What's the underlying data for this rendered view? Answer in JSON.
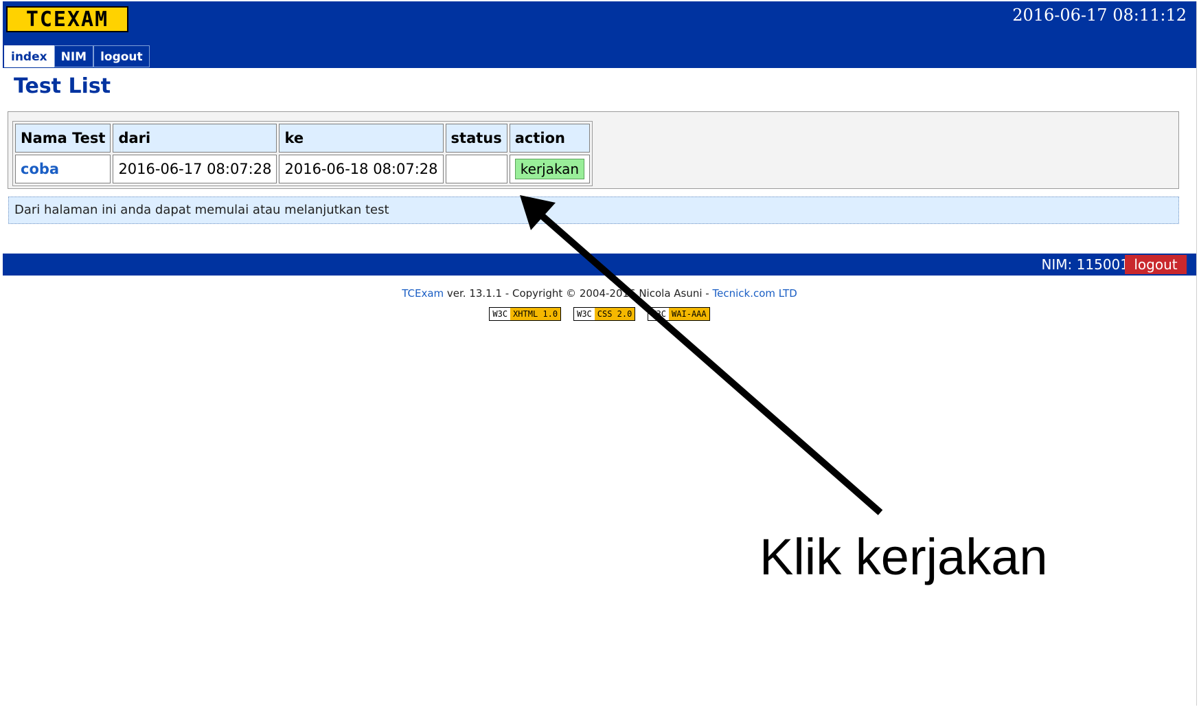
{
  "header": {
    "logo_text": "TCEXAM",
    "datetime": "2016-06-17 08:11:12"
  },
  "tabs": [
    {
      "label": "index",
      "active": true
    },
    {
      "label": "NIM",
      "active": false
    },
    {
      "label": "logout",
      "active": false
    }
  ],
  "page_title": "Test List",
  "table": {
    "columns": [
      "Nama Test",
      "dari",
      "ke",
      "status",
      "action"
    ],
    "rows": [
      {
        "name": "coba",
        "from": "2016-06-17 08:07:28",
        "to": "2016-06-18 08:07:28",
        "status": "",
        "action": "kerjakan"
      }
    ]
  },
  "info_text": "Dari halaman ini anda dapat memulai atau melanjutkan test",
  "footer": {
    "nim_label": "NIM: 115001",
    "logout_label": "logout",
    "copyright_prefix_link": "TCExam",
    "copyright_text": " ver. 13.1.1 - Copyright © 2004-2016 Nicola Asuni - ",
    "copyright_link": "Tecnick.com LTD",
    "badges": [
      {
        "left": "W3C",
        "right": "XHTML 1.0"
      },
      {
        "left": "W3C",
        "right": "CSS 2.0"
      },
      {
        "left": "W3C",
        "right": "WAI-AAA"
      }
    ]
  },
  "annotation": {
    "text": "Klik kerjakan"
  },
  "colors": {
    "header_blue": "#0033a0",
    "logo_yellow": "#ffd200",
    "table_header_bg": "#ddeeff",
    "action_green": "#99ee99",
    "logout_red": "#c9282d"
  }
}
